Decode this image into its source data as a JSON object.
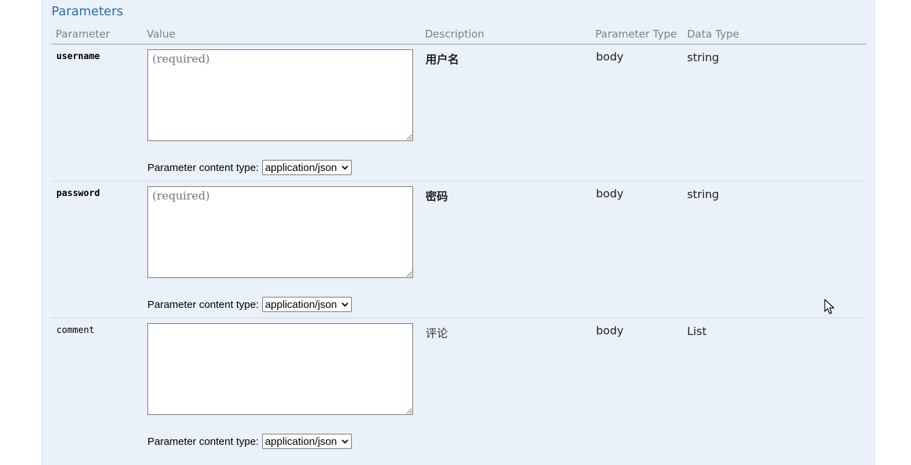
{
  "section": {
    "title": "Parameters"
  },
  "columns": {
    "parameter": "Parameter",
    "value": "Value",
    "description": "Description",
    "parameter_type": "Parameter Type",
    "data_type": "Data Type"
  },
  "params": [
    {
      "name": "username",
      "required": true,
      "value": "",
      "placeholder": "(required)",
      "description": "用户名",
      "parameter_type": "body",
      "data_type": "string",
      "content_type_label": "Parameter content type:",
      "content_type_value": "application/json"
    },
    {
      "name": "password",
      "required": true,
      "value": "",
      "placeholder": "(required)",
      "description": "密码",
      "parameter_type": "body",
      "data_type": "string",
      "content_type_label": "Parameter content type:",
      "content_type_value": "application/json"
    },
    {
      "name": "comment",
      "required": false,
      "value": "",
      "placeholder": "",
      "description": "评论",
      "parameter_type": "body",
      "data_type": "List",
      "content_type_label": "Parameter content type:",
      "content_type_value": "application/json"
    }
  ],
  "icons": {
    "select_chevron": "chevron-down-icon",
    "textarea_grip": "resize-grip-icon",
    "mouse": "mouse-cursor-icon"
  },
  "colors": {
    "panel_bg": "#ebf1f8",
    "title": "#1f6fb5",
    "column_header": "#808080"
  }
}
